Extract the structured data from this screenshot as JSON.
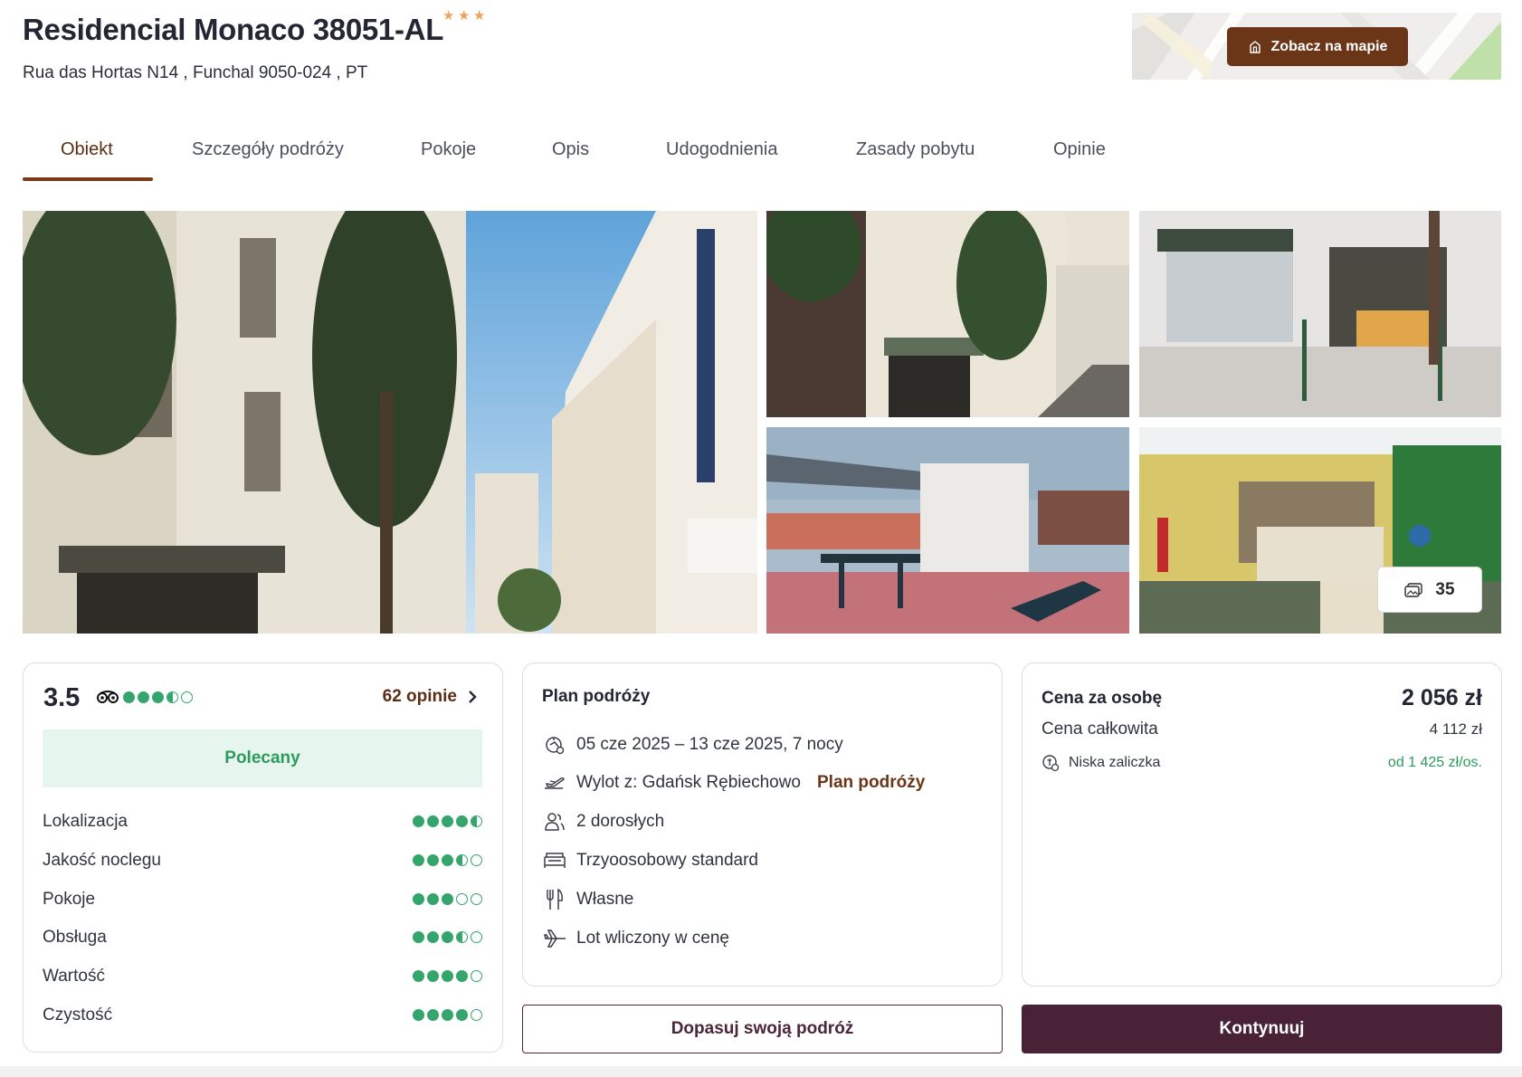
{
  "hotel": {
    "name": "Residencial Monaco 38051-AL",
    "stars": 3,
    "address": "Rua das Hortas N14 , Funchal 9050-024 , PT",
    "map_button_label": "Zobacz na mapie"
  },
  "tabs": [
    {
      "label": "Obiekt",
      "active": true
    },
    {
      "label": "Szczegóły podróży",
      "active": false
    },
    {
      "label": "Pokoje",
      "active": false
    },
    {
      "label": "Opis",
      "active": false
    },
    {
      "label": "Udogodnienia",
      "active": false
    },
    {
      "label": "Zasady pobytu",
      "active": false
    },
    {
      "label": "Opinie",
      "active": false
    }
  ],
  "gallery": {
    "photo_count": "35"
  },
  "rating": {
    "score": "3.5",
    "score_value": 3.5,
    "reviews_label": "62 opinie",
    "badge": "Polecany",
    "categories": [
      {
        "label": "Lokalizacja",
        "value": 4.5
      },
      {
        "label": "Jakość noclegu",
        "value": 3.5
      },
      {
        "label": "Pokoje",
        "value": 3.0
      },
      {
        "label": "Obsługa",
        "value": 3.5
      },
      {
        "label": "Wartość",
        "value": 4.0
      },
      {
        "label": "Czystość",
        "value": 4.0
      }
    ],
    "colors": {
      "dot": "#34a56b",
      "badge_bg": "#e6f6ee"
    }
  },
  "plan": {
    "title": "Plan podróży",
    "dates": "05 cze 2025 – 13 cze 2025, 7 nocy",
    "departure": "Wylot z: Gdańsk Rębiechowo",
    "departure_link": "Plan podróży",
    "guests": "2 dorosłych",
    "room": "Trzyoosobowy standard",
    "board": "Własne",
    "flight": "Lot wliczony w cenę"
  },
  "price": {
    "per_person_label": "Cena za osobę",
    "per_person_value": "2 056 zł",
    "total_label": "Cena całkowita",
    "total_value": "4 112 zł",
    "deposit_label": "Niska zaliczka",
    "deposit_value": "od 1 425 zł/os."
  },
  "actions": {
    "customize_label": "Dopasuj swoją podróż",
    "continue_label": "Kontynuuj"
  },
  "colors": {
    "accent_brown": "#6b3518",
    "primary_button": "#4a2238",
    "star": "#f0a25a"
  }
}
